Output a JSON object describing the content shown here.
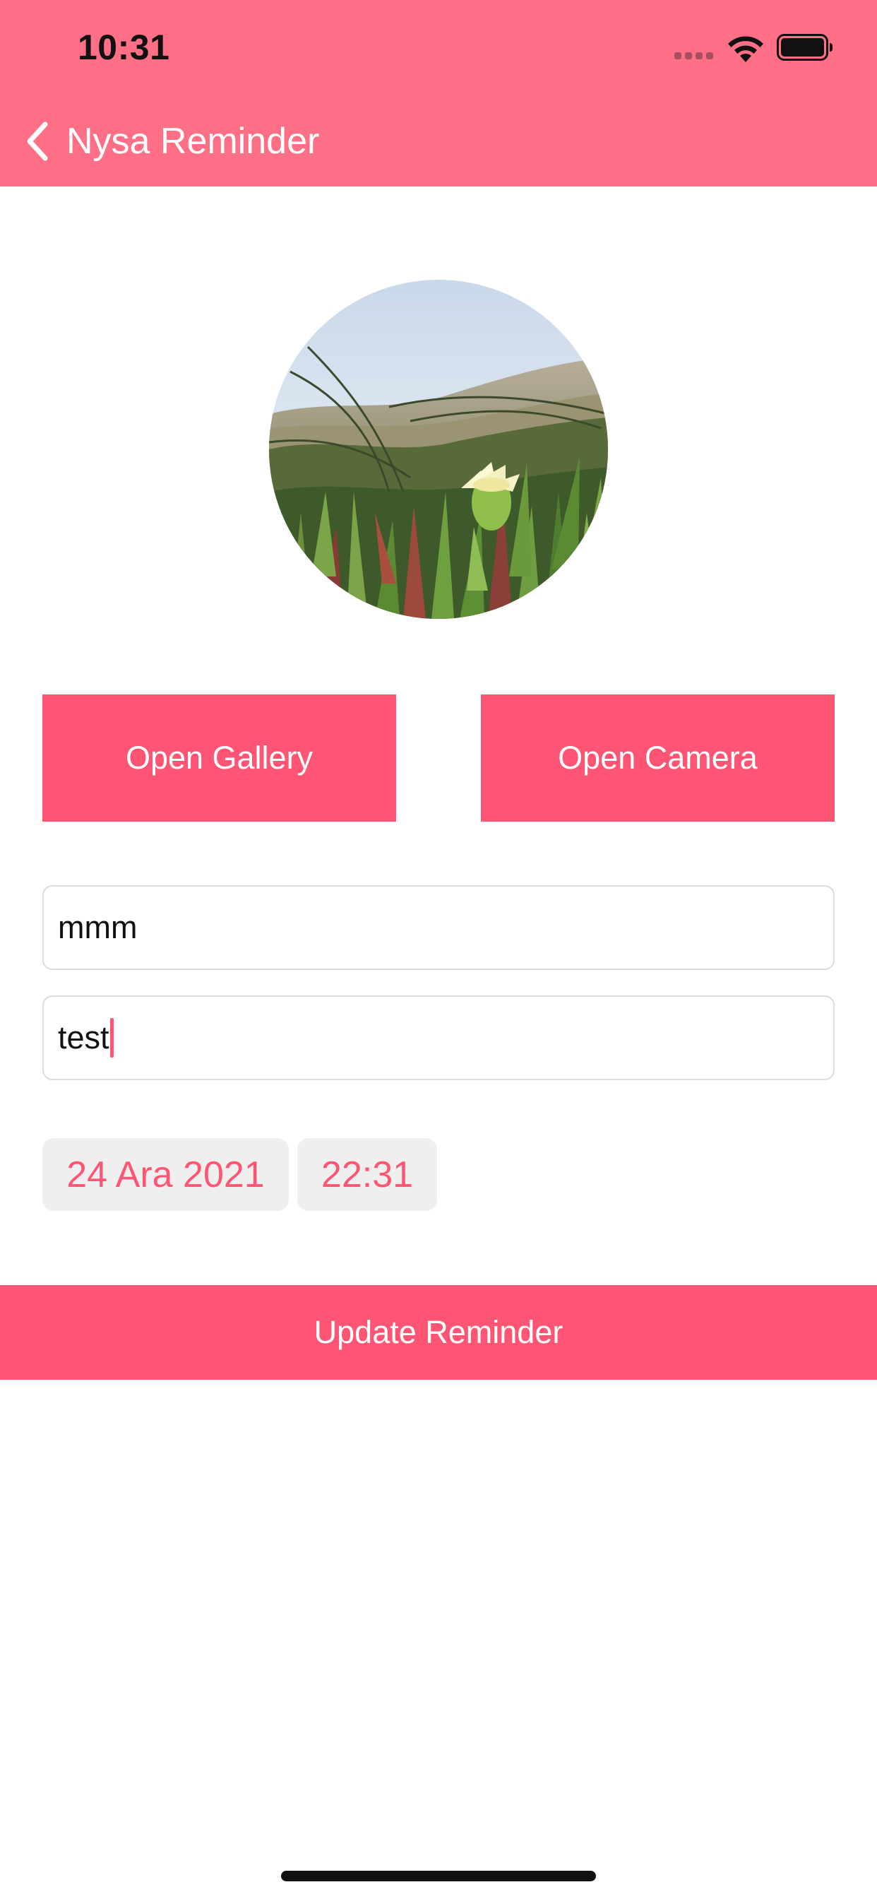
{
  "status_bar": {
    "time": "10:31"
  },
  "nav": {
    "title": "Nysa Reminder",
    "back_icon": "chevron-left-icon"
  },
  "photo": {
    "description_icon": "reminder-photo"
  },
  "buttons": {
    "open_gallery": "Open Gallery",
    "open_camera": "Open Camera",
    "update": "Update Reminder"
  },
  "form": {
    "title_value": "mmm",
    "note_value": "test",
    "date": "24 Ara 2021",
    "time": "22:31"
  },
  "colors": {
    "header": "#FF6F86",
    "accent": "#FF5574",
    "chip_background": "#EFEFF0"
  }
}
